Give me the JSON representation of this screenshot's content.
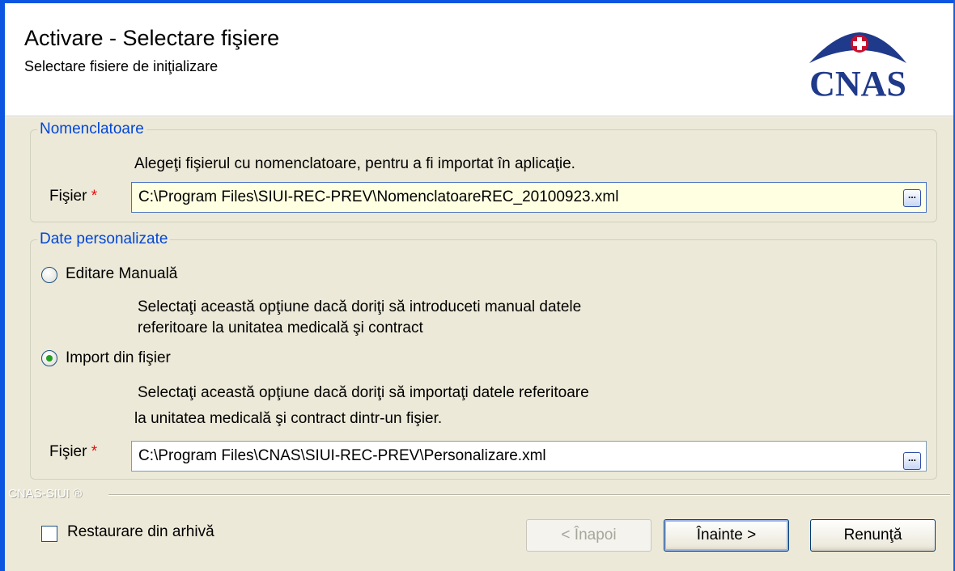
{
  "header": {
    "title": "Activare - Selectare fişiere",
    "subtitle": "Selectare fisiere de iniţializare",
    "logo_text": "CNAS"
  },
  "nomenclatoare": {
    "legend": "Nomenclatoare",
    "description": "Alegeţi fişierul cu nomenclatoare, pentru a fi importat în aplicaţie.",
    "file_label": "Fişier",
    "required_mark": "*",
    "file_value": "C:\\Program Files\\SIUI-REC-PREV\\NomenclatoareREC_20100923.xml",
    "browse_label": "..."
  },
  "personalized": {
    "legend": "Date personalizate",
    "option_manual": {
      "label": "Editare Manuală",
      "selected": false,
      "description_line1": "Selectaţi această opţiune dacă doriţi să introduceti manual datele",
      "description_line2": "referitoare la unitatea medicală şi contract"
    },
    "option_import": {
      "label": "Import din fişier",
      "selected": true,
      "description_line1": "Selectaţi această opţiune dacă doriţi să importaţi datele referitoare",
      "description_line2": "la unitatea medicală şi contract dintr-un fişier."
    },
    "file_label": "Fişier",
    "required_mark": "*",
    "file_value": "C:\\Program Files\\CNAS\\SIUI-REC-PREV\\Personalizare.xml",
    "browse_label": "..."
  },
  "footer": {
    "brand": "CNAS-SIUI ®",
    "restore_label": "Restaurare din arhivă",
    "restore_checked": false,
    "back_label": "< Înapoi",
    "next_label": "Înainte >",
    "cancel_label": "Renunţă"
  },
  "colors": {
    "accent": "#0046d5",
    "window_frame": "#0b55e0",
    "dialog_bg": "#ece9d8",
    "required": "#e01010",
    "logo_red": "#c8102e",
    "logo_blue": "#1f3a8a"
  }
}
